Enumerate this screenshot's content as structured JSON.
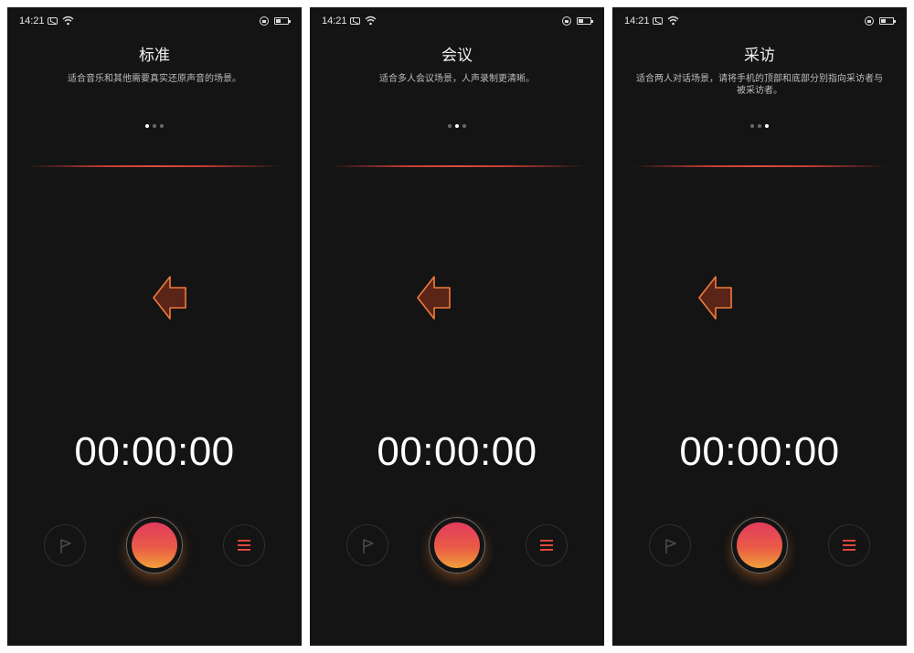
{
  "status_bar": {
    "time": "14:21"
  },
  "screens": [
    {
      "title": "标准",
      "description": "适合音乐和其他需要真实还原声音的场景。",
      "active_page": 1,
      "timer": "00:00:00"
    },
    {
      "title": "会议",
      "description": "适合多人会议场景，人声录制更清晰。",
      "active_page": 2,
      "timer": "00:00:00"
    },
    {
      "title": "采访",
      "description": "适合两人对话场景，请将手机的顶部和底部分别指向采访者与被采访者。",
      "active_page": 3,
      "timer": "00:00:00"
    }
  ],
  "page_count": 3,
  "icons": {
    "arrow": "left-arrow-icon",
    "mark": "flag-icon",
    "record": "record-icon",
    "list": "menu-icon"
  },
  "colors": {
    "background": "#141414",
    "accent": "#e0463c",
    "arrow_fill": "#5a2418",
    "arrow_stroke": "#f07a3a",
    "record_top": "#e23c5e",
    "record_bottom": "#f0a03a"
  }
}
